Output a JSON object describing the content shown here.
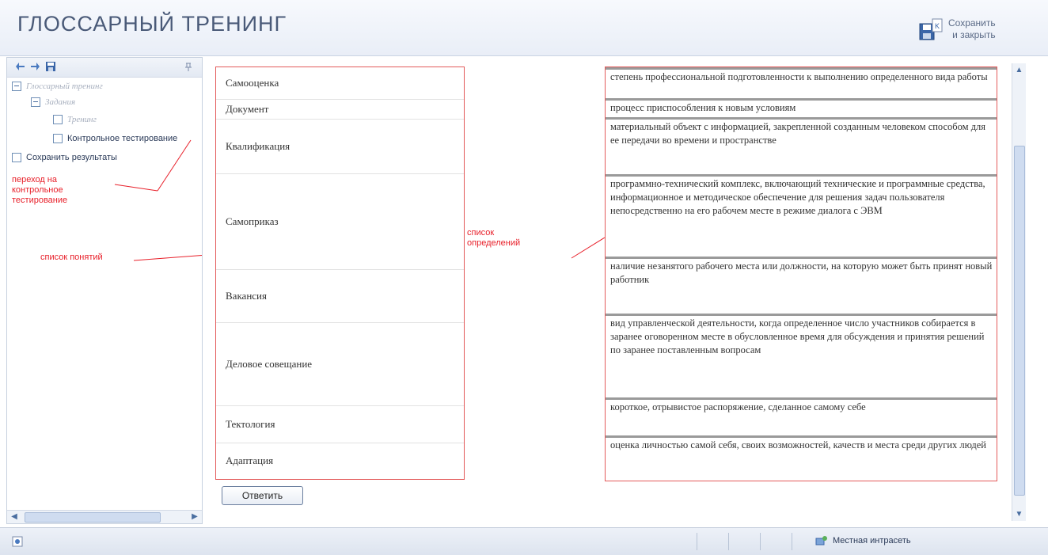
{
  "header": {
    "title": "ГЛОССАРНЫЙ ТРЕНИНГ",
    "save_line1": "Сохранить",
    "save_line2": "и закрыть"
  },
  "sidebar": {
    "tree": [
      {
        "label": "Глоссарный тренинг",
        "state": "disabled"
      },
      {
        "label": "Задания",
        "state": "disabled"
      },
      {
        "label": "Тренинг",
        "state": "disabled"
      },
      {
        "label": "Контрольное тестирование",
        "state": "enabled"
      },
      {
        "label": "Сохранить результаты",
        "state": "enabled"
      }
    ],
    "annotation1": [
      "переход на",
      "контрольное",
      "тестирование"
    ],
    "annotation2": "список понятий"
  },
  "main": {
    "concepts": [
      "Самооценка",
      "Документ",
      "Квалификация",
      "Самоприказ",
      "Вакансия",
      "Деловое совещание",
      "Тектология",
      "Адаптация"
    ],
    "definitions": [
      "степень профессиональной подготовленности к выполнению определенного вида работы",
      "процесс приспособления к новым условиям",
      "материальный объект с информацией, закрепленной созданным человеком способом для ее передачи во времени и пространстве",
      "программно-технический комплекс, включающий технические и программные средства, информационное и методическое обеспечение для решения задач пользователя непосредственно на его рабочем месте в режиме диалога с ЭВМ",
      "наличие незанятого рабочего места или должности, на которую может быть принят новый работник",
      "вид управленческой деятельности, когда определенное число участников собирается в заранее оговоренном месте в обусловленное время для обсуждения и принятия решений по заранее поставленным вопросам",
      "короткое, отрывистое распоряжение, сделанное самому себе",
      "оценка личностью самой себя, своих возможностей, качеств и места среди других людей"
    ],
    "annotation_defs": [
      "список",
      "определений"
    ],
    "answer_label": "Ответить"
  },
  "statusbar": {
    "zone": "Местная интрасеть"
  },
  "colors": {
    "annotation": "#e8202a",
    "annotation_border": "#e35a5a"
  }
}
